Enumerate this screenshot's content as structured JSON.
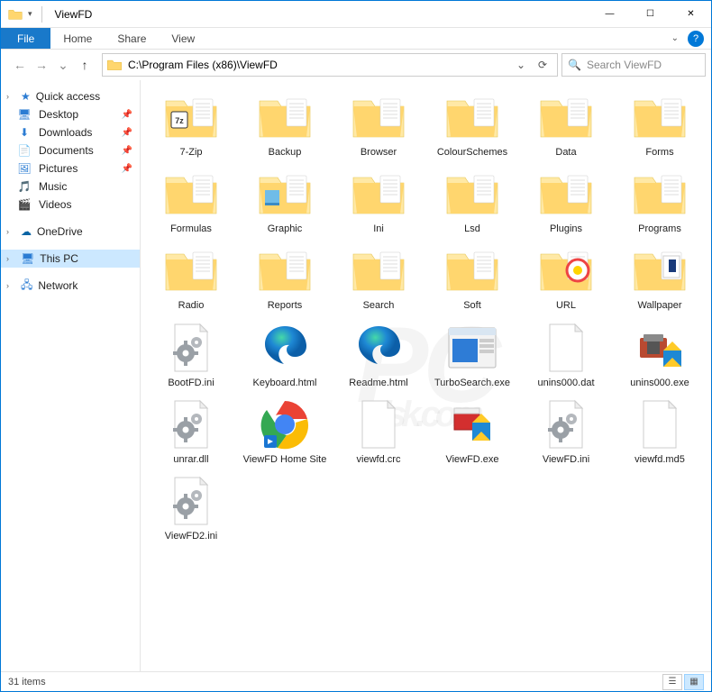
{
  "window": {
    "title": "ViewFD",
    "min_label": "—",
    "max_label": "☐",
    "close_label": "✕"
  },
  "ribbon": {
    "file": "File",
    "tabs": [
      "Home",
      "Share",
      "View"
    ]
  },
  "nav": {
    "back_glyph": "←",
    "forward_glyph": "→",
    "recent_glyph": "⌄",
    "up_glyph": "↑"
  },
  "address": {
    "path": "C:\\Program Files (x86)\\ViewFD",
    "dropdown_glyph": "⌄",
    "refresh_glyph": "⟳"
  },
  "search": {
    "placeholder": "Search ViewFD",
    "icon_glyph": "🔍"
  },
  "sidebar": {
    "quick_access": "Quick access",
    "items": [
      {
        "label": "Desktop",
        "icon": "desktop",
        "pinned": true
      },
      {
        "label": "Downloads",
        "icon": "downloads",
        "pinned": true
      },
      {
        "label": "Documents",
        "icon": "documents",
        "pinned": true
      },
      {
        "label": "Pictures",
        "icon": "pictures",
        "pinned": true
      },
      {
        "label": "Music",
        "icon": "music",
        "pinned": false
      },
      {
        "label": "Videos",
        "icon": "videos",
        "pinned": false
      }
    ],
    "onedrive": "OneDrive",
    "this_pc": "This PC",
    "network": "Network"
  },
  "files": [
    {
      "name": "7-Zip",
      "type": "folder-7z"
    },
    {
      "name": "Backup",
      "type": "folder"
    },
    {
      "name": "Browser",
      "type": "folder"
    },
    {
      "name": "ColourSchemes",
      "type": "folder"
    },
    {
      "name": "Data",
      "type": "folder"
    },
    {
      "name": "Forms",
      "type": "folder"
    },
    {
      "name": "Formulas",
      "type": "folder"
    },
    {
      "name": "Graphic",
      "type": "folder-preview"
    },
    {
      "name": "Ini",
      "type": "folder"
    },
    {
      "name": "Lsd",
      "type": "folder"
    },
    {
      "name": "Plugins",
      "type": "folder"
    },
    {
      "name": "Programs",
      "type": "folder"
    },
    {
      "name": "Radio",
      "type": "folder"
    },
    {
      "name": "Reports",
      "type": "folder"
    },
    {
      "name": "Search",
      "type": "folder"
    },
    {
      "name": "Soft",
      "type": "folder"
    },
    {
      "name": "URL",
      "type": "folder-url"
    },
    {
      "name": "Wallpaper",
      "type": "folder-img"
    },
    {
      "name": "BootFD.ini",
      "type": "ini"
    },
    {
      "name": "Keyboard.html",
      "type": "edge"
    },
    {
      "name": "Readme.html",
      "type": "edge"
    },
    {
      "name": "TurboSearch.exe",
      "type": "exe-window"
    },
    {
      "name": "unins000.dat",
      "type": "blank"
    },
    {
      "name": "unins000.exe",
      "type": "exe-unins"
    },
    {
      "name": "unrar.dll",
      "type": "ini"
    },
    {
      "name": "ViewFD Home Site",
      "type": "chrome"
    },
    {
      "name": "viewfd.crc",
      "type": "blank"
    },
    {
      "name": "ViewFD.exe",
      "type": "exe-red"
    },
    {
      "name": "ViewFD.ini",
      "type": "ini"
    },
    {
      "name": "viewfd.md5",
      "type": "blank"
    },
    {
      "name": "ViewFD2.ini",
      "type": "ini"
    }
  ],
  "status": {
    "count_text": "31 items"
  }
}
